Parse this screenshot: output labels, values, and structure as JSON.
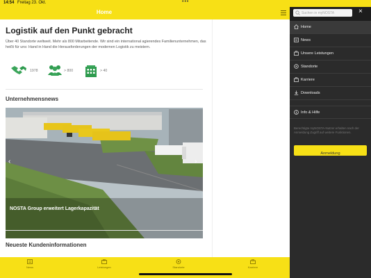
{
  "status_bar": {
    "time": "14:54",
    "date": "Freitag 23. Okt.",
    "dots": "•••"
  },
  "header": {
    "title": "Home"
  },
  "main": {
    "title": "Logistik auf den Punkt gebracht",
    "intro": "Über 40 Standorte weltweit. Mehr als 800 Mitarbeitende. Wir sind ein international agierendes Familienunternehmen, das heißt für uns: Hand in Hand die Herausforderungen der modernen Logistik zu meistern.",
    "stats": [
      {
        "icon": "handshake-icon",
        "value": "1978"
      },
      {
        "icon": "people-icon",
        "value": "> 800"
      },
      {
        "icon": "building-icon",
        "value": "> 40"
      }
    ],
    "news_section_title": "Unternehmensnews",
    "news_caption": "NOSTA Group erweitert Lagerkapazität",
    "customer_section_title": "Neueste Kundeninformationen"
  },
  "tabs": [
    {
      "label": "News",
      "icon": "news-icon"
    },
    {
      "label": "Leistungen",
      "icon": "services-icon"
    },
    {
      "label": "Standorte",
      "icon": "location-icon"
    },
    {
      "label": "Karriere",
      "icon": "career-icon"
    }
  ],
  "drawer": {
    "search_placeholder": "Suchen in myNOSTA",
    "items": [
      {
        "label": "Home",
        "icon": "home-icon"
      },
      {
        "label": "News",
        "icon": "news-icon"
      },
      {
        "label": "Unsere Leistungen",
        "icon": "services-icon"
      },
      {
        "label": "Standorte",
        "icon": "location-icon"
      },
      {
        "label": "Karriere",
        "icon": "career-icon"
      },
      {
        "label": "Downloads",
        "icon": "download-icon"
      },
      {
        "label": "Info & Hilfe",
        "icon": "info-icon"
      }
    ],
    "note": "Berechtigte myNOSTA-Nutzer erhalten nach der Anmeldung Zugriff auf weitere Funktionen.",
    "login_label": "Anmeldung"
  },
  "colors": {
    "brand_yellow": "#f7e016",
    "brand_green": "#2e9b4e",
    "drawer_bg": "#2b2b2b"
  }
}
